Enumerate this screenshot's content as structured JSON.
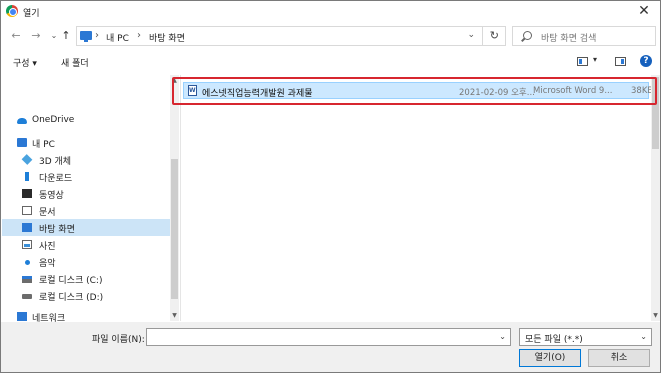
{
  "window": {
    "title": "열기",
    "close": "✕"
  },
  "navigation": {
    "back": "←",
    "forward": "→",
    "up": "↑"
  },
  "address": {
    "crumbs": [
      "내 PC",
      "바탕 화면"
    ],
    "separator": "›",
    "dropdown": "⌄",
    "refresh": "↻"
  },
  "search": {
    "placeholder": "바탕 화면 검색"
  },
  "toolbar": {
    "organize": "구성 ▾",
    "new_folder": "새 폴더",
    "view_dropdown": "▾",
    "help": "?"
  },
  "sidebar": {
    "items": [
      {
        "label": "OneDrive",
        "icon": "cloud-icon"
      },
      {
        "label": "내 PC",
        "icon": "pc-icon"
      },
      {
        "label": "3D 개체",
        "icon": "cube-icon"
      },
      {
        "label": "다운로드",
        "icon": "download-icon"
      },
      {
        "label": "동영상",
        "icon": "video-icon"
      },
      {
        "label": "문서",
        "icon": "document-icon"
      },
      {
        "label": "바탕 화면",
        "icon": "desktop-icon",
        "selected": true
      },
      {
        "label": "사진",
        "icon": "picture-icon"
      },
      {
        "label": "음악",
        "icon": "music-icon"
      },
      {
        "label": "로컬 디스크 (C:)",
        "icon": "system-drive-icon"
      },
      {
        "label": "로컬 디스크 (D:)",
        "icon": "drive-icon"
      },
      {
        "label": "네트워크",
        "icon": "network-icon"
      }
    ]
  },
  "files": [
    {
      "name": "에스넷직업능력개발원 과제물",
      "date": "2021-02-09 오후...",
      "type": "Microsoft Word 9...",
      "size": "38KB",
      "icon": "word-doc-icon",
      "selected": true
    }
  ],
  "footer": {
    "filename_label": "파일 이름(N):",
    "filename_value": "",
    "filetype": "모든 파일 (*.*)",
    "dropdown": "⌄",
    "open_button": "열기(O)",
    "cancel_button": "취소"
  },
  "colors": {
    "selection": "#cce8ff",
    "sidebar_selection": "#cce4f7",
    "highlight_box": "#d7262f",
    "accent": "#0078d7"
  }
}
